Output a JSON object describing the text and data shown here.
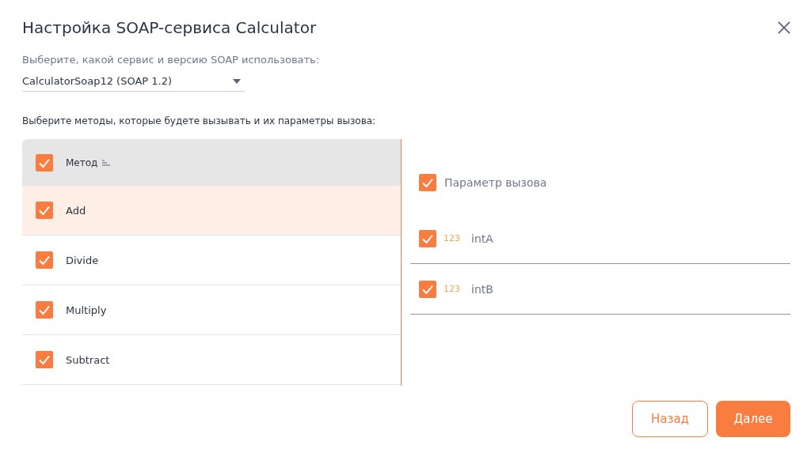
{
  "dialog": {
    "title": "Настройка SOAP-сервиса Calculator"
  },
  "service": {
    "label": "Выберите, какой сервис и версию SOAP использовать:",
    "value": "CalculatorSoap12 (SOAP 1.2)"
  },
  "methods_label": "Выберите методы, которые будете вызывать и их параметры вызова:",
  "methods": {
    "header": {
      "label": "Метод",
      "checked": true
    },
    "rows": [
      {
        "name": "Add",
        "checked": true,
        "selected": true
      },
      {
        "name": "Divide",
        "checked": true,
        "selected": false
      },
      {
        "name": "Multiply",
        "checked": true,
        "selected": false
      },
      {
        "name": "Subtract",
        "checked": true,
        "selected": false
      }
    ]
  },
  "parameters": {
    "header": {
      "label": "Параметр вызова",
      "checked": true
    },
    "rows": [
      {
        "type": "123",
        "name": "intA",
        "checked": true
      },
      {
        "type": "123",
        "name": "intB",
        "checked": true
      }
    ]
  },
  "buttons": [
    {
      "label": "Назад",
      "kind": "secondary"
    },
    {
      "label": "Далее",
      "kind": "primary"
    }
  ]
}
